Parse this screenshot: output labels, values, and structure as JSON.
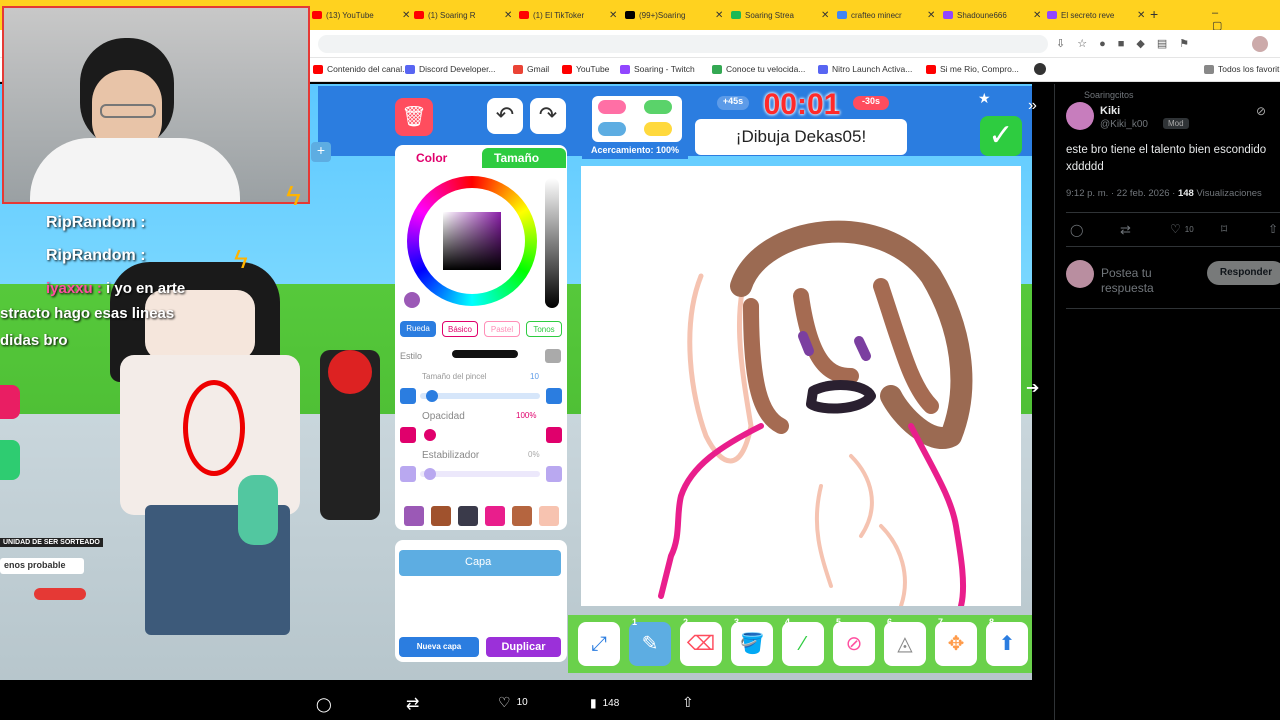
{
  "browser": {
    "tabs": [
      {
        "label": "(13) YouTube",
        "color": "#ff0000"
      },
      {
        "label": "(1) Soaring R",
        "color": "#ff0000"
      },
      {
        "label": "(1) El TikToker",
        "color": "#ff0000"
      },
      {
        "label": "(99+)Soaring",
        "color": "#000000"
      },
      {
        "label": "Soaring Strea",
        "color": "#1db954"
      },
      {
        "label": "crafteo minecr",
        "color": "#4285f4"
      },
      {
        "label": "Shadoune666",
        "color": "#9146ff"
      },
      {
        "label": "El secreto reve",
        "color": "#9146ff"
      }
    ],
    "new_tab": "+",
    "bookmarks": [
      {
        "label": "Contenido del canal...",
        "color": "#ff0000"
      },
      {
        "label": "Discord Developer...",
        "color": "#5865f2"
      },
      {
        "label": "Gmail",
        "color": "#ea4335"
      },
      {
        "label": "YouTube",
        "color": "#ff0000"
      },
      {
        "label": "Soaring - Twitch",
        "color": "#9146ff"
      },
      {
        "label": "Conoce tu velocida...",
        "color": "#34a853"
      },
      {
        "label": "Nitro Launch Activa...",
        "color": "#5865f2"
      },
      {
        "label": "Si me Rio, Compro...",
        "color": "#ff0000"
      }
    ],
    "all_bookmarks": "Todos los favorit"
  },
  "stream": {
    "chat": [
      {
        "user": "RipRandom :",
        "msg": ""
      },
      {
        "user": "RipRandom :",
        "msg": ""
      },
      {
        "user": "iyaxxu :",
        "msg": "i yo en arte"
      },
      {
        "user": "",
        "msg": "stracto hago esas lineas"
      },
      {
        "user": "",
        "msg": "didas bro"
      }
    ],
    "badge_left_1": "UNIDAD DE SER SORTEADO",
    "badge_left_2": "enos probable"
  },
  "game": {
    "timer": "00:01",
    "plus_time": "+45s",
    "minus_time": "-30s",
    "prompt": "¡Dibuja Dekas05!",
    "zoom_label": "Acercamiento: 100%",
    "tab_color": "Color",
    "tab_size": "Tamaño",
    "palette_modes": [
      "Rueda",
      "Básico",
      "Pastel",
      "Tonos"
    ],
    "style_label": "Estilo",
    "brush_size_label": "Tamaño del pincel",
    "brush_size_value": "10",
    "opacity_label": "Opacidad",
    "opacity_value": "100%",
    "stabilizer_label": "Estabilizador",
    "stabilizer_value": "0%",
    "swatches": [
      "#9b59b6",
      "#a0522d",
      "#3a3a4a",
      "#e91e8c",
      "#b5653f",
      "#f7c3b0"
    ],
    "layer_label": "Capa",
    "new_layer": "Nueva capa",
    "duplicate": "Duplicar",
    "tool_numbers": [
      "1",
      "2",
      "3",
      "4",
      "5",
      "6",
      "7",
      "8"
    ]
  },
  "tweet": {
    "header": "Soaringcitos",
    "name": "Kiki",
    "handle": "@Kiki_k00",
    "badge": "Mod",
    "text": "este bro tiene el talento bien escondido xddddd",
    "time": "9:12 p. m. · 22 feb. 2026 ·",
    "views_count": "148",
    "views_label": "Visualizaciones",
    "likes": "10",
    "reply_placeholder": "Postea tu respuesta",
    "reply_button": "Responder"
  },
  "bottom_bar": {
    "likes": "10",
    "views": "148"
  }
}
